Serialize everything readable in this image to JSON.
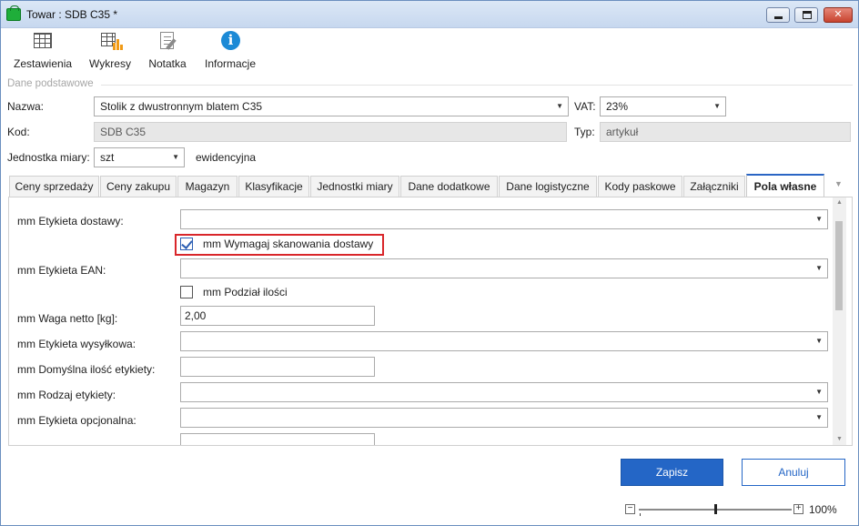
{
  "window": {
    "title": "Towar : SDB C35 *"
  },
  "toolbar": {
    "items": [
      {
        "label": "Zestawienia",
        "icon": "table-icon"
      },
      {
        "label": "Wykresy",
        "icon": "chart-table-icon"
      },
      {
        "label": "Notatka",
        "icon": "note-icon"
      },
      {
        "label": "Informacje",
        "icon": "info-icon"
      }
    ]
  },
  "basic": {
    "section_title": "Dane podstawowe",
    "name_label": "Nazwa:",
    "name_value": "Stolik z dwustronnym blatem C35",
    "vat_label": "VAT:",
    "vat_value": "23%",
    "code_label": "Kod:",
    "code_value": "SDB C35",
    "type_label": "Typ:",
    "type_value": "artykuł",
    "unit_label": "Jednostka miary:",
    "unit_value": "szt",
    "unit_kind": "ewidencyjna"
  },
  "tabs": {
    "items": [
      "Ceny sprzedaży",
      "Ceny zakupu",
      "Magazyn",
      "Klasyfikacje",
      "Jednostki miary",
      "Dane dodatkowe",
      "Dane logistyczne",
      "Kody paskowe",
      "Załączniki",
      "Pola własne"
    ],
    "active": "Pola własne"
  },
  "custom_fields": {
    "etykieta_dostawy_label": "mm Etykieta dostawy:",
    "wymagaj_skanowania_label": "mm Wymagaj skanowania dostawy",
    "wymagaj_skanowania_checked": true,
    "etykieta_ean_label": "mm Etykieta EAN:",
    "podzial_ilosci_label": "mm Podział ilości",
    "podzial_ilosci_checked": false,
    "waga_netto_label": "mm Waga netto [kg]:",
    "waga_netto_value": "2,00",
    "etykieta_wysylkowa_label": "mm Etykieta wysyłkowa:",
    "domyslna_ilosc_label": "mm Domyślna ilość etykiety:",
    "domyslna_ilosc_value": "",
    "rodzaj_etykiety_label": "mm Rodzaj etykiety:",
    "etykieta_opcjonalna_label": "mm Etykieta opcjonalna:",
    "highlight_color": "#d9262a"
  },
  "actions": {
    "save_label": "Zapisz",
    "cancel_label": "Anuluj",
    "accent": "#2466c6"
  },
  "zoom": {
    "level": "100%",
    "minus": "−",
    "plus": "+"
  }
}
